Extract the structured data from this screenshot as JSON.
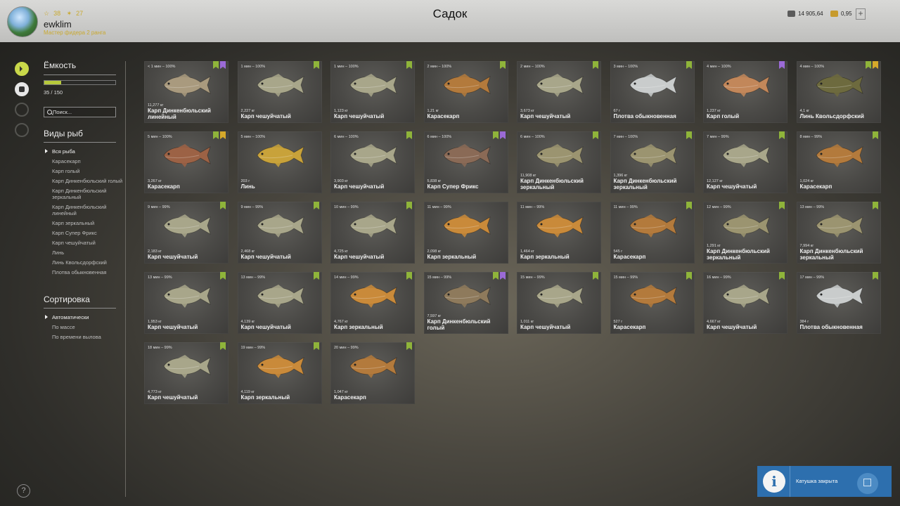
{
  "header": {
    "level": "38",
    "rating": "27",
    "username": "ewklim",
    "rank_title": "Мастер фидера 2 ранга",
    "title": "Садок",
    "silver": "14 905,64",
    "gold": "0,95",
    "plus": "+"
  },
  "left": {
    "capacity_title": "Ёмкость",
    "capacity_text": "35 / 150",
    "capacity_fraction": 0.233,
    "search_placeholder": "Поиск...",
    "species_title": "Виды рыб",
    "species": [
      "Вся рыба",
      "Карасекарп",
      "Карп голый",
      "Карп Динкенбюльский голый",
      "Карп Динкенбюльский зеркальный",
      "Карп Динкенбюльский линейный",
      "Карп зеркальный",
      "Карп Супер Фрикс",
      "Карп чешуйчатый",
      "Линь",
      "Линь Квольсдорфский",
      "Плотва обыкновенная"
    ],
    "sort_title": "Сортировка",
    "sort": [
      "Автоматически",
      "По массе",
      "По времени вылова"
    ],
    "help": "?"
  },
  "colors": {
    "green": "#8fb43a",
    "purple": "#9b6ad6",
    "yellow": "#d6a92a",
    "accent": "#b7c93b",
    "notify": "#2d6fae"
  },
  "fish": [
    {
      "time": "< 1 мин – 100%",
      "weight": "11,277 кг",
      "name": "Карп Динкенбюльский линейный",
      "badges": [
        "green",
        "purple"
      ],
      "tint": "#a99a7e"
    },
    {
      "time": "1 мин – 100%",
      "weight": "2,227 кг",
      "name": "Карп чешуйчатый",
      "badges": [
        "green"
      ],
      "tint": "#a8a68a"
    },
    {
      "time": "1 мин – 100%",
      "weight": "1,123 кг",
      "name": "Карп чешуйчатый",
      "badges": [
        "green"
      ],
      "tint": "#a8a68a"
    },
    {
      "time": "2 мин – 100%",
      "weight": "1,21 кг",
      "name": "Карасекарп",
      "badges": [
        "green"
      ],
      "tint": "#b37a3c"
    },
    {
      "time": "2 мин – 100%",
      "weight": "3,673 кг",
      "name": "Карп чешуйчатый",
      "badges": [
        "green"
      ],
      "tint": "#a8a68a"
    },
    {
      "time": "3 мин – 100%",
      "weight": "67 г",
      "name": "Плотва обыкновенная",
      "badges": [
        "green"
      ],
      "tint": "#c9cccc"
    },
    {
      "time": "4 мин – 100%",
      "weight": "1,237 кг",
      "name": "Карп голый",
      "badges": [
        "purple"
      ],
      "tint": "#c2875a"
    },
    {
      "time": "4 мин – 100%",
      "weight": "4,1 кг",
      "name": "Линь Квольсдорфский",
      "badges": [
        "green",
        "yellow"
      ],
      "tint": "#6d6a3e"
    },
    {
      "time": "5 мин – 100%",
      "weight": "3,267 кг",
      "name": "Карасекарп",
      "badges": [
        "green",
        "yellow"
      ],
      "tint": "#9c6245"
    },
    {
      "time": "5 мин – 100%",
      "weight": "203 г",
      "name": "Линь",
      "badges": [],
      "tint": "#c8a23a"
    },
    {
      "time": "6 мин – 100%",
      "weight": "3,903 кг",
      "name": "Карп чешуйчатый",
      "badges": [
        "green"
      ],
      "tint": "#a8a68a"
    },
    {
      "time": "6 мин – 100%",
      "weight": "5,838 кг",
      "name": "Карп Супер Фрикс",
      "badges": [
        "green",
        "purple"
      ],
      "tint": "#8a6a56"
    },
    {
      "time": "6 мин – 100%",
      "weight": "11,908 кг",
      "name": "Карп Динкенбюльский зеркальный",
      "badges": [
        "green"
      ],
      "tint": "#9b9470"
    },
    {
      "time": "7 мин – 100%",
      "weight": "1,396 кг",
      "name": "Карп Динкенбюльский зеркальный",
      "badges": [
        "green"
      ],
      "tint": "#9b9470"
    },
    {
      "time": "7 мин – 99%",
      "weight": "12,127 кг",
      "name": "Карп чешуйчатый",
      "badges": [
        "green"
      ],
      "tint": "#a8a68a"
    },
    {
      "time": "8 мин – 99%",
      "weight": "1,024 кг",
      "name": "Карасекарп",
      "badges": [
        "green"
      ],
      "tint": "#b37a3c"
    },
    {
      "time": "9 мин – 99%",
      "weight": "2,183 кг",
      "name": "Карп чешуйчатый",
      "badges": [
        "green"
      ],
      "tint": "#a8a68a"
    },
    {
      "time": "9 мин – 99%",
      "weight": "2,468 кг",
      "name": "Карп чешуйчатый",
      "badges": [
        "green"
      ],
      "tint": "#a8a68a"
    },
    {
      "time": "10 мин – 99%",
      "weight": "4,725 кг",
      "name": "Карп чешуйчатый",
      "badges": [
        "green"
      ],
      "tint": "#a8a68a"
    },
    {
      "time": "11 мин – 99%",
      "weight": "2,098 кг",
      "name": "Карп зеркальный",
      "badges": [],
      "tint": "#c98a3a"
    },
    {
      "time": "11 мин – 99%",
      "weight": "1,464 кг",
      "name": "Карп зеркальный",
      "badges": [],
      "tint": "#c98a3a"
    },
    {
      "time": "11 мин – 99%",
      "weight": "545 г",
      "name": "Карасекарп",
      "badges": [
        "green"
      ],
      "tint": "#b37a3c"
    },
    {
      "time": "12 мин – 99%",
      "weight": "1,291 кг",
      "name": "Карп Динкенбюльский зеркальный",
      "badges": [
        "green"
      ],
      "tint": "#9b9470"
    },
    {
      "time": "13 мин – 99%",
      "weight": "7,994 кг",
      "name": "Карп Динкенбюльский зеркальный",
      "badges": [
        "green"
      ],
      "tint": "#9b9470"
    },
    {
      "time": "13 мин – 99%",
      "weight": "1,953 кг",
      "name": "Карп чешуйчатый",
      "badges": [
        "green"
      ],
      "tint": "#a8a68a"
    },
    {
      "time": "13 мин – 99%",
      "weight": "4,139 кг",
      "name": "Карп чешуйчатый",
      "badges": [
        "green"
      ],
      "tint": "#a8a68a"
    },
    {
      "time": "14 мин – 99%",
      "weight": "4,767 кг",
      "name": "Карп зеркальный",
      "badges": [
        "green"
      ],
      "tint": "#c98a3a"
    },
    {
      "time": "15 мин – 99%",
      "weight": "7,597 кг",
      "name": "Карп Динкенбюльский голый",
      "badges": [
        "green",
        "purple"
      ],
      "tint": "#8e7a5c"
    },
    {
      "time": "15 мин – 99%",
      "weight": "1,011 кг",
      "name": "Карп чешуйчатый",
      "badges": [
        "green"
      ],
      "tint": "#a8a68a"
    },
    {
      "time": "15 мин – 99%",
      "weight": "527 г",
      "name": "Карасекарп",
      "badges": [
        "green"
      ],
      "tint": "#b37a3c"
    },
    {
      "time": "16 мин – 99%",
      "weight": "4,667 кг",
      "name": "Карп чешуйчатый",
      "badges": [
        "green"
      ],
      "tint": "#a8a68a"
    },
    {
      "time": "17 мин – 99%",
      "weight": "384 г",
      "name": "Плотва обыкновенная",
      "badges": [
        "green"
      ],
      "tint": "#c9cccc"
    },
    {
      "time": "18 мин – 99%",
      "weight": "4,773 кг",
      "name": "Карп чешуйчатый",
      "badges": [
        "green"
      ],
      "tint": "#a8a68a"
    },
    {
      "time": "19 мин – 99%",
      "weight": "4,119 кг",
      "name": "Карп зеркальный",
      "badges": [
        "green"
      ],
      "tint": "#c98a3a"
    },
    {
      "time": "20 мин – 99%",
      "weight": "1,047 кг",
      "name": "Карасекарп",
      "badges": [
        "green"
      ],
      "tint": "#b37a3c"
    }
  ],
  "notification": {
    "icon": "i",
    "text": "Катушка закрыта"
  }
}
